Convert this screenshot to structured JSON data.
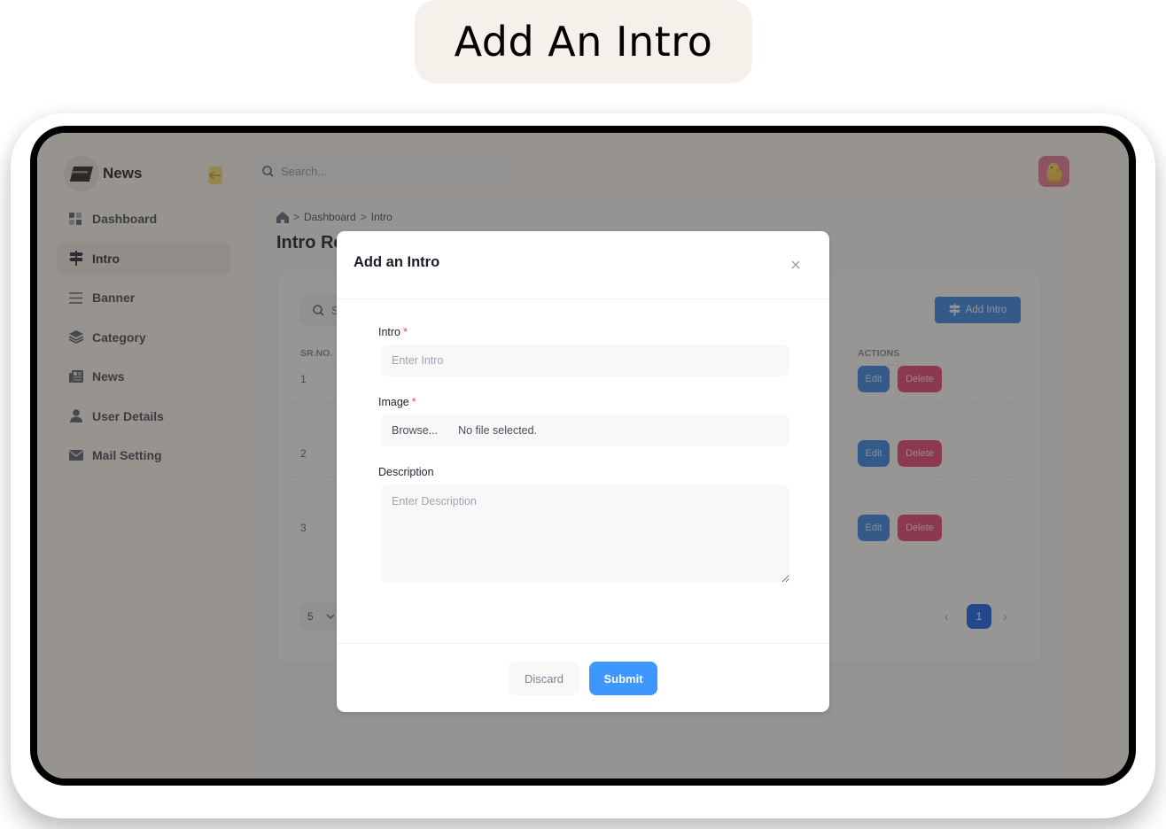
{
  "caption": "Add An Intro",
  "app": {
    "brand": "News",
    "search_placeholder": "Search...",
    "sidebar": {
      "items": [
        {
          "label": "Dashboard",
          "icon": "dashboard-icon",
          "active": false
        },
        {
          "label": "Intro",
          "icon": "signpost-icon",
          "active": true
        },
        {
          "label": "Banner",
          "icon": "menu-lines-icon",
          "active": false
        },
        {
          "label": "Category",
          "icon": "layers-icon",
          "active": false
        },
        {
          "label": "News",
          "icon": "newspaper-icon",
          "active": false
        },
        {
          "label": "User Details",
          "icon": "user-icon",
          "active": false
        },
        {
          "label": "Mail Setting",
          "icon": "mail-icon",
          "active": false
        }
      ]
    },
    "breadcrumb": [
      "Dashboard",
      "Intro"
    ],
    "page_title": "Intro Records",
    "table": {
      "search_placeholder": "Search",
      "add_button": "Add Intro",
      "columns": [
        "SR.NO.",
        "ACTIONS"
      ],
      "rows": [
        {
          "sr": "1",
          "edit": "Edit",
          "delete": "Delete"
        },
        {
          "sr": "2",
          "edit": "Edit",
          "delete": "Delete"
        },
        {
          "sr": "3",
          "edit": "Edit",
          "delete": "Delete"
        }
      ],
      "page_size": "5",
      "pagination": {
        "prev": "‹",
        "current": "1",
        "next": "›"
      }
    }
  },
  "modal": {
    "title": "Add an Intro",
    "fields": {
      "intro": {
        "label": "Intro",
        "required_mark": "*",
        "placeholder": "Enter Intro",
        "value": ""
      },
      "image": {
        "label": "Image",
        "required_mark": "*",
        "browse": "Browse...",
        "status": "No file selected."
      },
      "description": {
        "label": "Description",
        "placeholder": "Enter Description",
        "value": ""
      }
    },
    "discard_label": "Discard",
    "submit_label": "Submit"
  },
  "colors": {
    "primary": "#3e97ff",
    "danger": "#e33a6a",
    "required": "#f1416c",
    "pager_active": "#0a58e6"
  }
}
